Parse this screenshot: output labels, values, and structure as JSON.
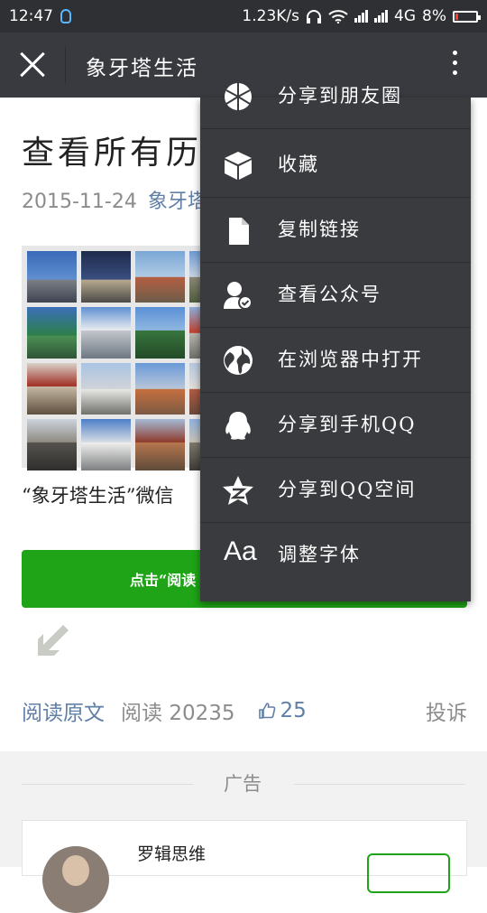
{
  "status_bar": {
    "time": "12:47",
    "speed": "1.23K/s",
    "network": "4G",
    "battery": "8%"
  },
  "titlebar": {
    "title": "象牙塔生活",
    "icons": [
      "close-icon",
      "more-icon"
    ]
  },
  "article": {
    "headline": "查看所有历史",
    "date": "2015-11-24",
    "author": "象牙塔",
    "caption": "“象牙塔生活”微信",
    "button_text": "点击“阅读",
    "read_original": "阅读原文",
    "reads_label": "阅读",
    "reads_count": "20235",
    "likes": "25",
    "report": "投诉"
  },
  "ad": {
    "label": "广告",
    "name": "罗辑思维"
  },
  "menu": {
    "items": [
      {
        "label": "分享到朋友圈",
        "icon": "moments-icon"
      },
      {
        "label": "收藏",
        "icon": "favorite-cube-icon"
      },
      {
        "label": "复制链接",
        "icon": "copy-link-icon"
      },
      {
        "label": "查看公众号",
        "icon": "official-account-icon"
      },
      {
        "label": "在浏览器中打开",
        "icon": "globe-icon"
      },
      {
        "label": "分享到手机QQ",
        "icon": "qq-penguin-icon"
      },
      {
        "label": "分享到QQ空间",
        "icon": "qzone-star-icon"
      },
      {
        "label": "调整字体",
        "icon": "font-size-icon",
        "icon_text": "Aa"
      }
    ]
  },
  "colors": {
    "titlebar": "#393a3f",
    "menu": "#3a3b3f",
    "button_green": "#1ea416",
    "link_blue": "#607fa6"
  }
}
